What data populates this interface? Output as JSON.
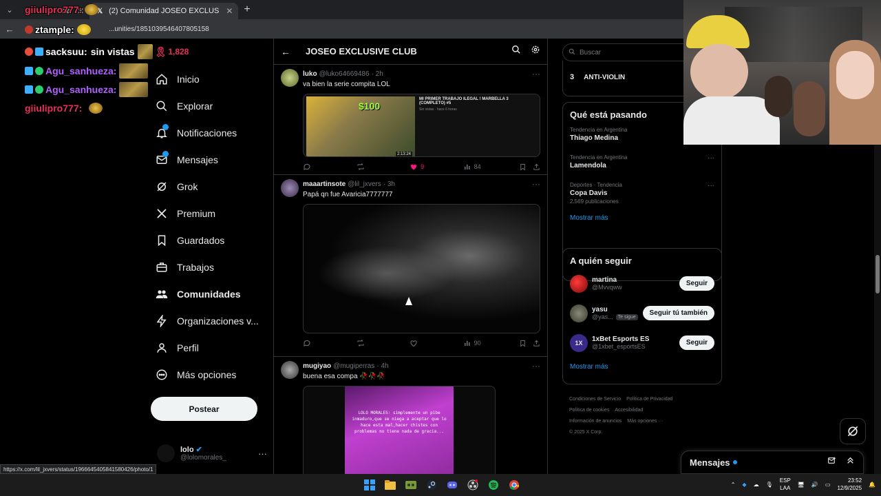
{
  "browser": {
    "tabs": [
      {
        "label": "...ouTube"
      },
      {
        "label": "(2) Comunidad JOSEO EXCLUS"
      }
    ],
    "url": "...unities/1851039546407805158",
    "status_link": "https://x.com/lil_jxvers/status/1966645405841580426/photo/1"
  },
  "chat": {
    "lines": [
      {
        "user": "giiulipro777:",
        "color": "#e8325a",
        "text": ""
      },
      {
        "user": "ztample:",
        "color": "#ffffff",
        "text": ""
      },
      {
        "user": "sacksuu:",
        "color": "#ffffff",
        "text": "sin vistas",
        "extra": "1,828"
      },
      {
        "user": "Agu_sanhueza:",
        "color": "#b061ff",
        "text": ""
      },
      {
        "user": "Agu_sanhueza:",
        "color": "#b061ff",
        "text": ""
      },
      {
        "user": "giiulipro777:",
        "color": "#e8325a",
        "text": ""
      }
    ]
  },
  "nav": {
    "items": [
      {
        "label": "Inicio",
        "icon": "home-icon"
      },
      {
        "label": "Explorar",
        "icon": "search-icon"
      },
      {
        "label": "Notificaciones",
        "icon": "bell-icon",
        "badge": true
      },
      {
        "label": "Mensajes",
        "icon": "mail-icon",
        "badge": true
      },
      {
        "label": "Grok",
        "icon": "grok-icon"
      },
      {
        "label": "Premium",
        "icon": "x-logo-icon"
      },
      {
        "label": "Guardados",
        "icon": "bookmark-icon"
      },
      {
        "label": "Trabajos",
        "icon": "briefcase-icon"
      },
      {
        "label": "Comunidades",
        "icon": "people-icon",
        "active": true
      },
      {
        "label": "Organizaciones v...",
        "icon": "lightning-icon"
      },
      {
        "label": "Perfil",
        "icon": "person-icon"
      },
      {
        "label": "Más opciones",
        "icon": "more-circle-icon"
      }
    ],
    "post_label": "Postear",
    "profile": {
      "name": "lolo",
      "handle": "@lolomorales_"
    }
  },
  "main": {
    "title": "JOSEO EXCLUSIVE CLUB",
    "tweets": [
      {
        "name": "luko",
        "handle": "@luko64669486",
        "time": "· 2h",
        "text": "va bien la serie compita LOL",
        "card": {
          "title": "MI PRIMER TRABAJO ILEGAL ! MARBELLA 3 (COMPLETO) #5",
          "sub": "Sin vistas · hace 6 horas",
          "price": "$100",
          "duration": "2:13:24"
        },
        "likes": "9",
        "views": "84",
        "liked": true
      },
      {
        "name": "maaartinsote",
        "handle": "@lil_jxvers",
        "time": "· 3h",
        "text": "Papá qn fue Avaricia7777777",
        "likes": "",
        "views": "90",
        "liked": false
      },
      {
        "name": "mugiyao",
        "handle": "@mugiperras",
        "time": "· 4h",
        "text": "buena esa compa 🥀🥀🥀",
        "caption": "LOLO MORALES: simplemente un pibe inmaduro,que se niega a aceptar que lo hace esta mal,hacer chistes con problemas no tiene nada de gracia..."
      }
    ]
  },
  "right": {
    "search_placeholder": "Buscar",
    "community_rank": {
      "num": "3",
      "name": "ANTI-VIOLIN"
    },
    "trends_title": "Qué está pasando",
    "trends": [
      {
        "meta": "Tendencia en Argentina",
        "name": "Thiago Medina",
        "count": ""
      },
      {
        "meta": "Tendencia en Argentina",
        "name": "Lamendola",
        "count": ""
      },
      {
        "meta": "Deportes · Tendencia",
        "name": "Copa Davis",
        "count": "2.569 publicaciones"
      }
    ],
    "show_more": "Mostrar más",
    "follow_title": "A quién seguir",
    "follows": [
      {
        "name": "martina",
        "handle": "@Mvvqww",
        "button": "Seguir",
        "tag": ""
      },
      {
        "name": "yasu",
        "handle": "@yas...",
        "button": "Seguir tú también",
        "tag": "Te sigue"
      },
      {
        "name": "1xBet Esports ES",
        "handle": "@1xbet_esportsES",
        "button": "Seguir",
        "tag": ""
      }
    ],
    "footer": [
      "Condiciones de Servicio",
      "Política de Privacidad",
      "Política de cookies",
      "Accesibilidad",
      "Información de anuncios",
      "Más opciones ···",
      "© 2025 X Corp."
    ]
  },
  "messages": {
    "title": "Mensajes"
  },
  "taskbar": {
    "lang1": "ESP",
    "lang2": "LAA",
    "time": "23:52",
    "date": "12/9/2025"
  },
  "colors": {
    "accent": "#1d9bf0",
    "like": "#f91880",
    "bg": "#000000",
    "border": "#2f3336"
  }
}
